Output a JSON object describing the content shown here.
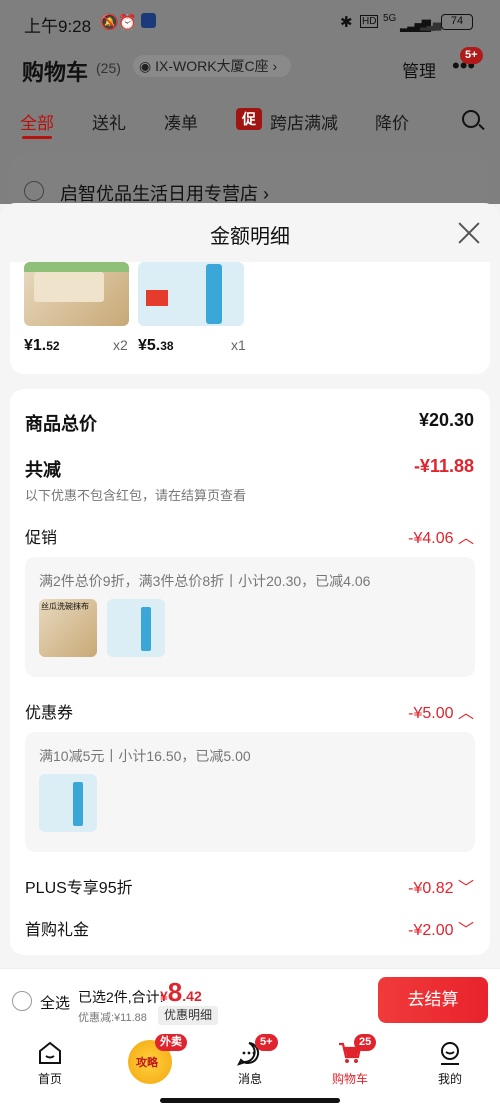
{
  "status_bar": {
    "time": "上午9:28",
    "signal": "5G",
    "battery": "74"
  },
  "header": {
    "title": "购物车",
    "count": "(25)",
    "location": "IX-WORK大厦C座",
    "manage": "管理",
    "more_badge": "5+"
  },
  "tabs": [
    {
      "label": "全部",
      "active": true
    },
    {
      "label": "送礼",
      "active": false
    },
    {
      "label": "凑单",
      "active": false
    },
    {
      "label": "跨店满减",
      "active": false,
      "chip": "促"
    },
    {
      "label": "降价",
      "active": false
    }
  ],
  "store": {
    "name": "启智优品生活日用专营店"
  },
  "sheet": {
    "title": "金额明细",
    "products": [
      {
        "price_int": "¥1.",
        "price_dec": "52",
        "qty": "x2"
      },
      {
        "price_int": "¥5.",
        "price_dec": "38",
        "qty": "x1"
      }
    ],
    "total_label": "商品总价",
    "total_value": "¥20.30",
    "discount_label": "共减",
    "discount_value": "-¥11.88",
    "discount_note": "以下优惠不包含红包，请在结算页查看",
    "promo": {
      "label": "促销",
      "value": "-¥4.06",
      "detail": "满2件总价9折，满3件总价8折丨小计20.30，已减4.06",
      "thumb_label": "丝瓜洗碗抹布"
    },
    "coupon": {
      "label": "优惠券",
      "value": "-¥5.00",
      "detail": "满10减5元丨小计16.50，已减5.00"
    },
    "plus": {
      "label": "PLUS专享95折",
      "value": "-¥0.82"
    },
    "first": {
      "label": "首购礼金",
      "value": "-¥2.00"
    }
  },
  "checkout": {
    "select_all": "全选",
    "selected": "已选2件,合计:",
    "currency": "¥",
    "amount_int": "8",
    "amount_dec": ".42",
    "discount": "优惠减:¥11.88",
    "detail_link": "优惠明细",
    "pay": "去结算"
  },
  "nav": [
    {
      "label": "首页",
      "icon": "home-icon"
    },
    {
      "label": "",
      "icon": "takeaway-icon",
      "badge": "外卖",
      "sub": "攻略"
    },
    {
      "label": "消息",
      "icon": "message-icon",
      "badge": "5+"
    },
    {
      "label": "购物车",
      "icon": "cart-icon",
      "badge": "25",
      "active": true
    },
    {
      "label": "我的",
      "icon": "profile-icon"
    }
  ],
  "colors": {
    "accent": "#e0242d",
    "overlay": "#7f7f7f"
  }
}
